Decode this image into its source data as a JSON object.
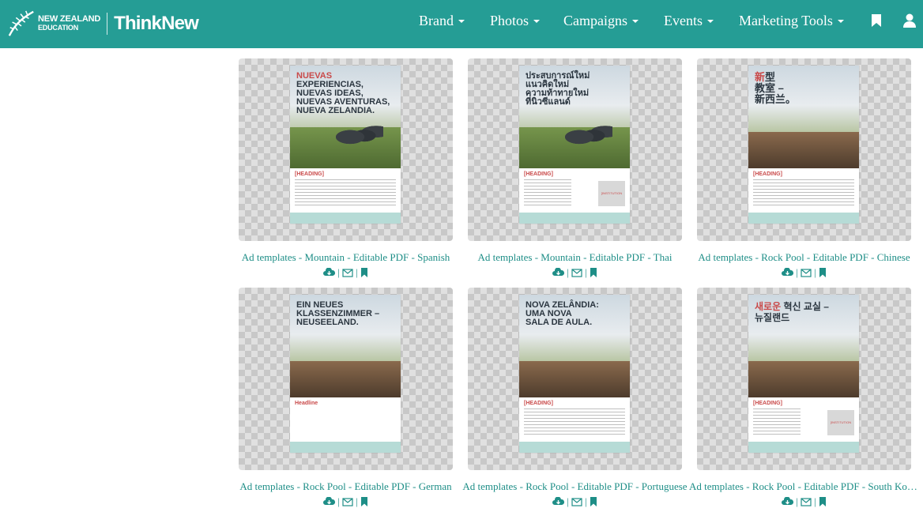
{
  "brand": {
    "org_line1": "NEW ZEALAND",
    "org_line2": "EDUCATION",
    "product": "ThinkNew"
  },
  "nav": {
    "items": [
      {
        "label": "Brand"
      },
      {
        "label": "Photos"
      },
      {
        "label": "Campaigns"
      },
      {
        "label": "Events"
      },
      {
        "label": "Marketing Tools"
      }
    ],
    "icons": [
      "bookmark-icon",
      "user-icon"
    ]
  },
  "colors": {
    "nav_bg": "#259d95",
    "link": "#1e8e87",
    "accent_red": "#c94a4a"
  },
  "action_separator": "|",
  "cards": [
    {
      "title": "Ad templates - Mountain - Editable PDF - Spanish",
      "poster": {
        "headline_red": "NUEVAS",
        "headline": "EXPERIENCIAS,\nNUEVAS IDEAS,\nNUEVAS AVENTURAS,\nNUEVA ZELANDIA.",
        "heading": "[HEADING]",
        "scene": "mountain"
      }
    },
    {
      "title": "Ad templates - Mountain - Editable PDF - Thai",
      "poster": {
        "headline_red": "",
        "headline": "ประสบการณ์ใหม่\nแนวคิดใหม่\nความท้าทายใหม่\nที่นิวซีแลนด์",
        "heading": "[HEADING]",
        "scene": "mountain",
        "logo": "[INSTITUTION LOGO]"
      }
    },
    {
      "title": "Ad templates - Rock Pool - Editable PDF - Chinese",
      "poster": {
        "headline_red": "新",
        "headline": "型\n教室 –\n新西兰。",
        "heading": "[HEADING]",
        "scene": "rock"
      }
    },
    {
      "title": "Ad templates - Rock Pool - Editable PDF - German",
      "poster": {
        "headline_red": "",
        "headline": "EIN NEUES\nKLASSENZIMMER –\nNEUSEELAND.",
        "heading": "Headline",
        "scene": "rock"
      }
    },
    {
      "title": "Ad templates - Rock Pool - Editable PDF - Portuguese",
      "poster": {
        "headline_red": "",
        "headline": "NOVA ZELÂNDIA:\nUMA NOVA\nSALA DE AULA.",
        "heading": "[HEADING]",
        "scene": "rock"
      }
    },
    {
      "title": "Ad templates - Rock Pool - Editable PDF - South Korean",
      "poster": {
        "headline_red": "새로운",
        "headline": " 혁신 교실 –\n뉴질랜드",
        "heading": "[HEADING]",
        "scene": "rock",
        "logo": "[INSTITUTION LOGO]"
      }
    }
  ]
}
